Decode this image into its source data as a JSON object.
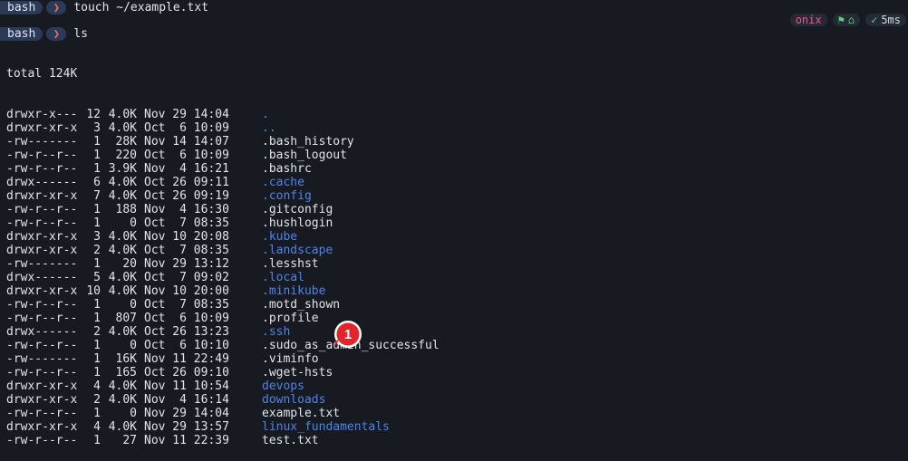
{
  "prompts": [
    {
      "shell": "bash",
      "arrow": "❯",
      "command": "touch ~/example.txt"
    },
    {
      "shell": "bash",
      "arrow": "❯",
      "command": "ls"
    }
  ],
  "status": {
    "host": "onix",
    "dir_icon": "⚑",
    "home_icon": "⌂",
    "check": "✓",
    "duration": "5ms"
  },
  "total": "total 124K",
  "rows": [
    {
      "perm": "drwxr-x---",
      "links": "12",
      "size": "4.0K",
      "date": "Nov 29 14:04",
      "name": ".",
      "type": "dir"
    },
    {
      "perm": "drwxr-xr-x",
      "links": "3",
      "size": "4.0K",
      "date": "Oct  6 10:09",
      "name": "..",
      "type": "dir"
    },
    {
      "perm": "-rw-------",
      "links": "1",
      "size": "28K",
      "date": "Nov 14 14:07",
      "name": ".bash_history",
      "type": "file"
    },
    {
      "perm": "-rw-r--r--",
      "links": "1",
      "size": "220",
      "date": "Oct  6 10:09",
      "name": ".bash_logout",
      "type": "file"
    },
    {
      "perm": "-rw-r--r--",
      "links": "1",
      "size": "3.9K",
      "date": "Nov  4 16:21",
      "name": ".bashrc",
      "type": "file"
    },
    {
      "perm": "drwx------",
      "links": "6",
      "size": "4.0K",
      "date": "Oct 26 09:11",
      "name": ".cache",
      "type": "dir"
    },
    {
      "perm": "drwxr-xr-x",
      "links": "7",
      "size": "4.0K",
      "date": "Oct 26 09:19",
      "name": ".config",
      "type": "dir"
    },
    {
      "perm": "-rw-r--r--",
      "links": "1",
      "size": "188",
      "date": "Nov  4 16:30",
      "name": ".gitconfig",
      "type": "file"
    },
    {
      "perm": "-rw-r--r--",
      "links": "1",
      "size": "0",
      "date": "Oct  7 08:35",
      "name": ".hushlogin",
      "type": "file"
    },
    {
      "perm": "drwxr-xr-x",
      "links": "3",
      "size": "4.0K",
      "date": "Nov 10 20:08",
      "name": ".kube",
      "type": "dir"
    },
    {
      "perm": "drwxr-xr-x",
      "links": "2",
      "size": "4.0K",
      "date": "Oct  7 08:35",
      "name": ".landscape",
      "type": "dir"
    },
    {
      "perm": "-rw-------",
      "links": "1",
      "size": "20",
      "date": "Nov 29 13:12",
      "name": ".lesshst",
      "type": "file"
    },
    {
      "perm": "drwx------",
      "links": "5",
      "size": "4.0K",
      "date": "Oct  7 09:02",
      "name": ".local",
      "type": "dir"
    },
    {
      "perm": "drwxr-xr-x",
      "links": "10",
      "size": "4.0K",
      "date": "Nov 10 20:00",
      "name": ".minikube",
      "type": "dir"
    },
    {
      "perm": "-rw-r--r--",
      "links": "1",
      "size": "0",
      "date": "Oct  7 08:35",
      "name": ".motd_shown",
      "type": "file"
    },
    {
      "perm": "-rw-r--r--",
      "links": "1",
      "size": "807",
      "date": "Oct  6 10:09",
      "name": ".profile",
      "type": "file"
    },
    {
      "perm": "drwx------",
      "links": "2",
      "size": "4.0K",
      "date": "Oct 26 13:23",
      "name": ".ssh",
      "type": "dir"
    },
    {
      "perm": "-rw-r--r--",
      "links": "1",
      "size": "0",
      "date": "Oct  6 10:10",
      "name": ".sudo_as_admin_successful",
      "type": "file"
    },
    {
      "perm": "-rw-------",
      "links": "1",
      "size": "16K",
      "date": "Nov 11 22:49",
      "name": ".viminfo",
      "type": "file"
    },
    {
      "perm": "-rw-r--r--",
      "links": "1",
      "size": "165",
      "date": "Oct 26 09:10",
      "name": ".wget-hsts",
      "type": "file"
    },
    {
      "perm": "drwxr-xr-x",
      "links": "4",
      "size": "4.0K",
      "date": "Nov 11 10:54",
      "name": "devops",
      "type": "dir"
    },
    {
      "perm": "drwxr-xr-x",
      "links": "2",
      "size": "4.0K",
      "date": "Nov  4 16:14",
      "name": "downloads",
      "type": "dir"
    },
    {
      "perm": "-rw-r--r--",
      "links": "1",
      "size": "0",
      "date": "Nov 29 14:04",
      "name": "example.txt",
      "type": "file"
    },
    {
      "perm": "drwxr-xr-x",
      "links": "4",
      "size": "4.0K",
      "date": "Nov 29 13:57",
      "name": "linux_fundamentals",
      "type": "dir"
    },
    {
      "perm": "-rw-r--r--",
      "links": "1",
      "size": "27",
      "date": "Nov 11 22:39",
      "name": "test.txt",
      "type": "file"
    }
  ],
  "marker": {
    "label": "1",
    "color": "#e0252b"
  }
}
